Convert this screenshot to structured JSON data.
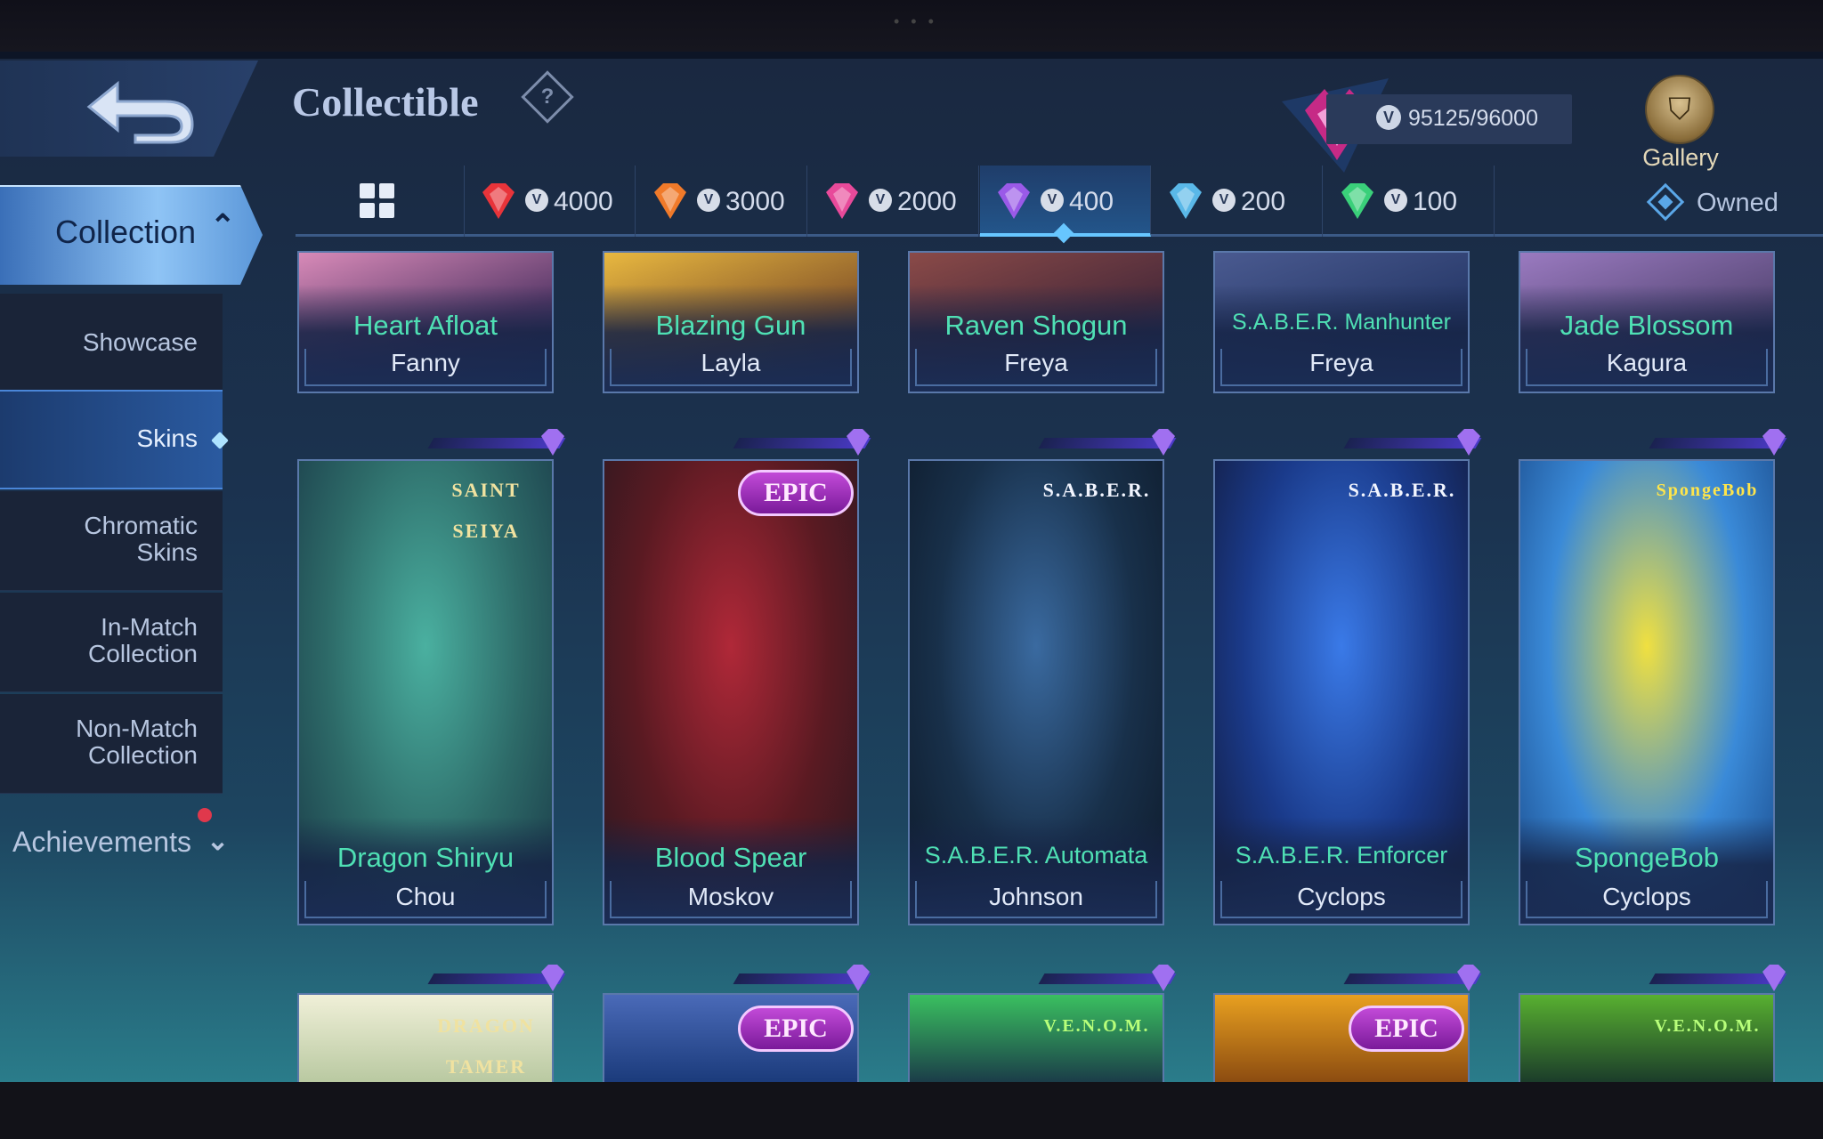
{
  "header": {
    "title": "Collectible",
    "points": "95125/96000",
    "gallery_label": "Gallery"
  },
  "sidebar": {
    "collection_label": "Collection",
    "items": [
      {
        "label": "Showcase"
      },
      {
        "label": "Skins"
      },
      {
        "label": "Chromatic\nSkins"
      },
      {
        "label": "In-Match\nCollection"
      },
      {
        "label": "Non-Match\nCollection"
      }
    ],
    "achievements_label": "Achievements"
  },
  "tiers": {
    "tabs": [
      {
        "value": "4000",
        "color": "#e8343a"
      },
      {
        "value": "3000",
        "color": "#f07a2a"
      },
      {
        "value": "2000",
        "color": "#e84a9a"
      },
      {
        "value": "400",
        "color": "#9a5ae8"
      },
      {
        "value": "200",
        "color": "#5ab8e8"
      },
      {
        "value": "100",
        "color": "#3ad07a"
      }
    ],
    "active": "400",
    "owned_label": "Owned"
  },
  "cards": {
    "row1": [
      {
        "skin": "Heart Afloat",
        "hero": "Fanny"
      },
      {
        "skin": "Blazing Gun",
        "hero": "Layla"
      },
      {
        "skin": "Raven Shogun",
        "hero": "Freya"
      },
      {
        "skin": "S.A.B.E.R. Manhunter",
        "hero": "Freya"
      },
      {
        "skin": "Jade Blossom",
        "hero": "Kagura"
      }
    ],
    "row2": [
      {
        "skin": "Dragon Shiryu",
        "hero": "Chou",
        "badge": "SAINT SEIYA"
      },
      {
        "skin": "Blood Spear",
        "hero": "Moskov",
        "badge": "EPIC"
      },
      {
        "skin": "S.A.B.E.R. Automata",
        "hero": "Johnson",
        "badge": "S.A.B.E.R."
      },
      {
        "skin": "S.A.B.E.R. Enforcer",
        "hero": "Cyclops",
        "badge": "S.A.B.E.R."
      },
      {
        "skin": "SpongeBob",
        "hero": "Cyclops",
        "badge": "SpongeBob"
      }
    ],
    "row3": [
      {
        "badge": "DRAGON TAMER"
      },
      {
        "badge": "EPIC"
      },
      {
        "badge": "V.E.N.O.M."
      },
      {
        "badge": "EPIC"
      },
      {
        "badge": "V.E.N.O.M."
      }
    ]
  }
}
